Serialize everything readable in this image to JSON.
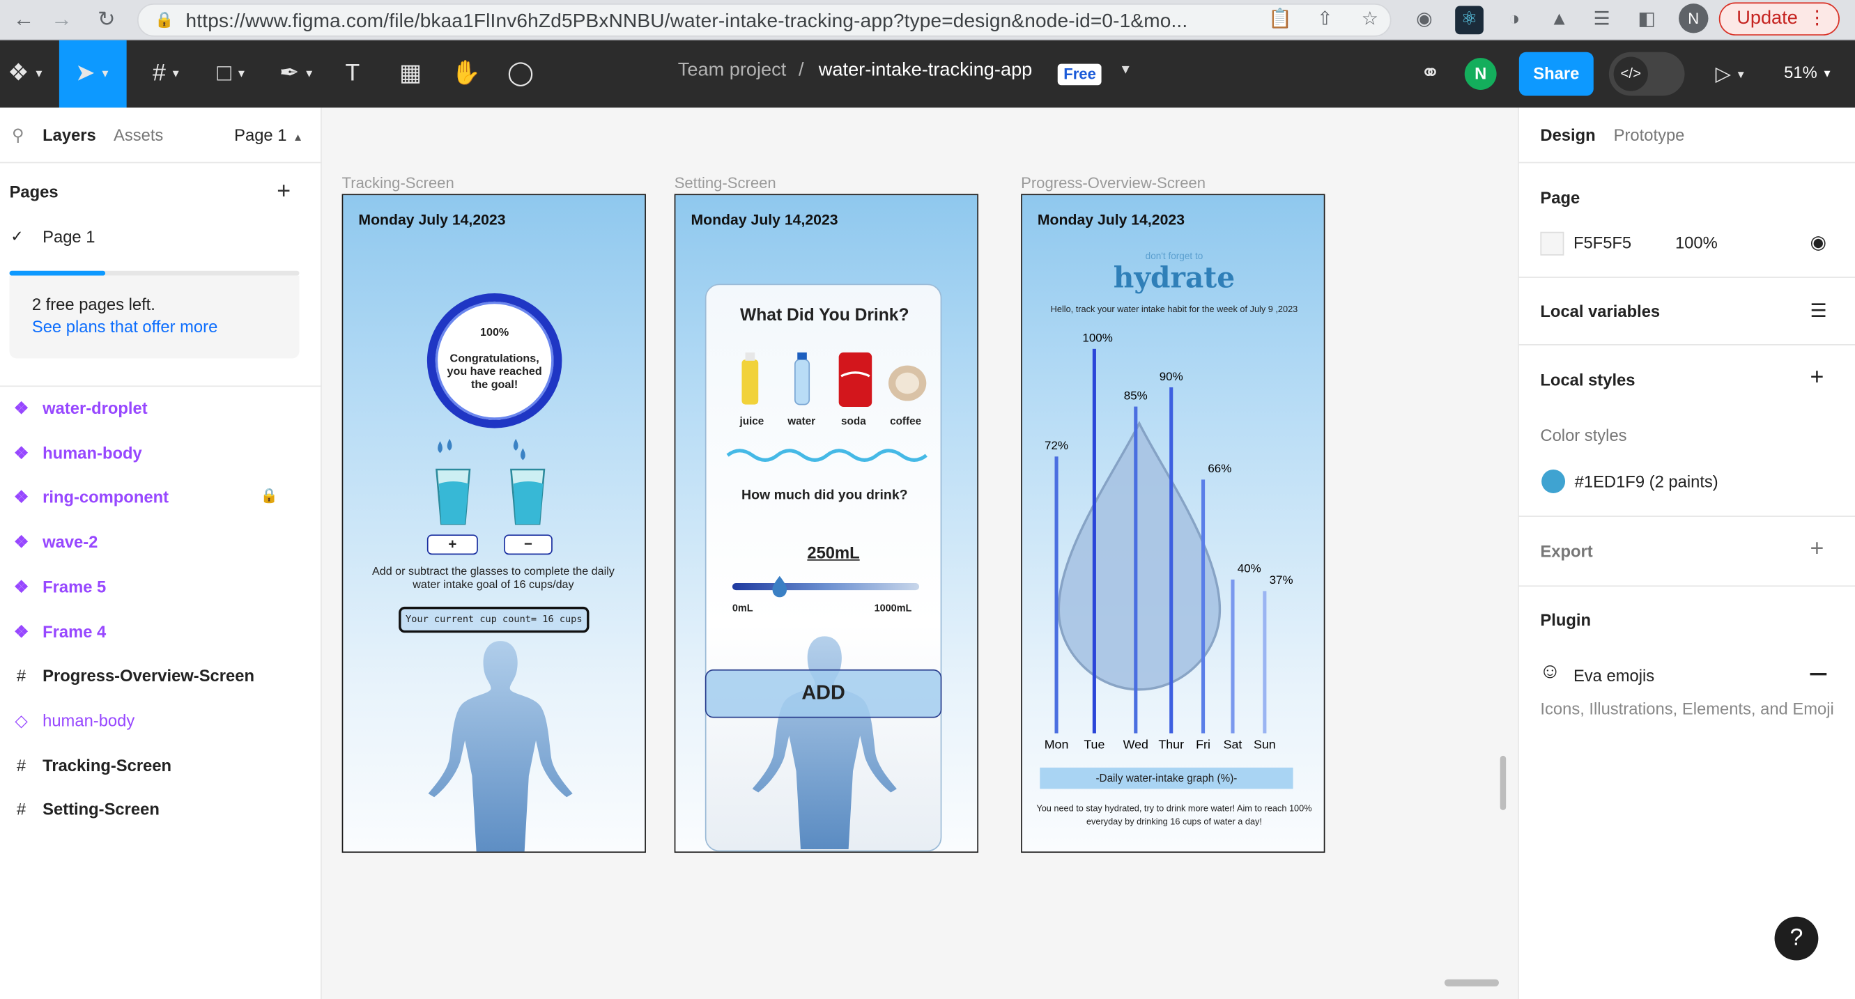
{
  "browser": {
    "url": "https://www.figma.com/file/bkaa1FlInv6hZd5PBxNNBU/water-intake-tracking-app?type=design&node-id=0-1&mo...",
    "update_label": "Update",
    "avatar_letter": "N"
  },
  "toolbar": {
    "team": "Team project",
    "separator": "/",
    "file_name": "water-intake-tracking-app",
    "plan_badge": "Free",
    "user_initial": "N",
    "share_label": "Share",
    "zoom": "51%"
  },
  "left_panel": {
    "tabs": [
      "Layers",
      "Assets"
    ],
    "page_selector": "Page 1",
    "pages_heading": "Pages",
    "pages": [
      "Page 1"
    ],
    "free_pages_progress": 0.33,
    "free_pages_text": "2 free pages left.",
    "plans_link": "See plans that offer more",
    "layers": [
      {
        "name": "water-droplet",
        "kind": "component"
      },
      {
        "name": "human-body",
        "kind": "component"
      },
      {
        "name": "ring-component",
        "kind": "component",
        "locked": true
      },
      {
        "name": "wave-2",
        "kind": "component"
      },
      {
        "name": "Frame 5",
        "kind": "component"
      },
      {
        "name": "Frame 4",
        "kind": "component"
      },
      {
        "name": "Progress-Overview-Screen",
        "kind": "frame"
      },
      {
        "name": "human-body",
        "kind": "instance"
      },
      {
        "name": "Tracking-Screen",
        "kind": "frame"
      },
      {
        "name": "Setting-Screen",
        "kind": "frame"
      }
    ]
  },
  "canvas": {
    "tracking": {
      "label": "Tracking-Screen",
      "date": "Monday July 14,2023",
      "ring_percent": "100%",
      "ring_message": "Congratulations, you have reached the goal!",
      "plus": "+",
      "minus": "−",
      "instructions": "Add or subtract the glasses to complete the daily water intake goal of 16 cups/day",
      "cup_count": "Your current cup count= 16 cups"
    },
    "setting": {
      "label": "Setting-Screen",
      "date": "Monday July 14,2023",
      "question": "What Did You Drink?",
      "drinks": [
        "juice",
        "water",
        "soda",
        "coffee"
      ],
      "amount_question": "How much did you drink?",
      "amount": "250mL",
      "slider_min": "0mL",
      "slider_max": "1000mL",
      "slider_fraction": 0.25,
      "add_label": "ADD"
    },
    "overview": {
      "label": "Progress-Overview-Screen",
      "date": "Monday July 14,2023",
      "logo_top": "don't forget to",
      "logo_main": "hydrate",
      "subtitle": "Hello, track your water intake habit for the week of July 9 ,2023",
      "graph_caption": "-Daily water-intake graph (%)-",
      "footer": "You need to stay hydrated, try to drink more water! Aim to reach 100% everyday by drinking 16 cups of water a day!"
    }
  },
  "chart_data": {
    "type": "bar",
    "categories": [
      "Mon",
      "Tue",
      "Wed",
      "Thur",
      "Fri",
      "Sat",
      "Sun"
    ],
    "values": [
      72,
      100,
      85,
      90,
      66,
      40,
      37
    ],
    "value_labels": [
      "72%",
      "100%",
      "85%",
      "90%",
      "66%",
      "40%",
      "37%"
    ],
    "title": "-Daily water-intake graph (%)-",
    "ylim": [
      0,
      100
    ],
    "bar_colors": [
      "#4a6ee0",
      "#2a45d8",
      "#4a6ee0",
      "#3d5fe0",
      "#5a7ee8",
      "#7a98ee",
      "#9ab4f2"
    ]
  },
  "right_panel": {
    "tabs": [
      "Design",
      "Prototype"
    ],
    "page_heading": "Page",
    "page_color": "F5F5F5",
    "page_opacity": "100%",
    "local_variables": "Local variables",
    "local_styles": "Local styles",
    "color_styles": "Color styles",
    "color_style_name": "#1ED1F9 (2 paints)",
    "color_style_swatch": "#3fa3d1",
    "export": "Export",
    "plugin": "Plugin",
    "plugin_name": "Eva emojis",
    "plugin_desc": "Icons, Illustrations, Elements, and Emoji"
  },
  "help": "?"
}
